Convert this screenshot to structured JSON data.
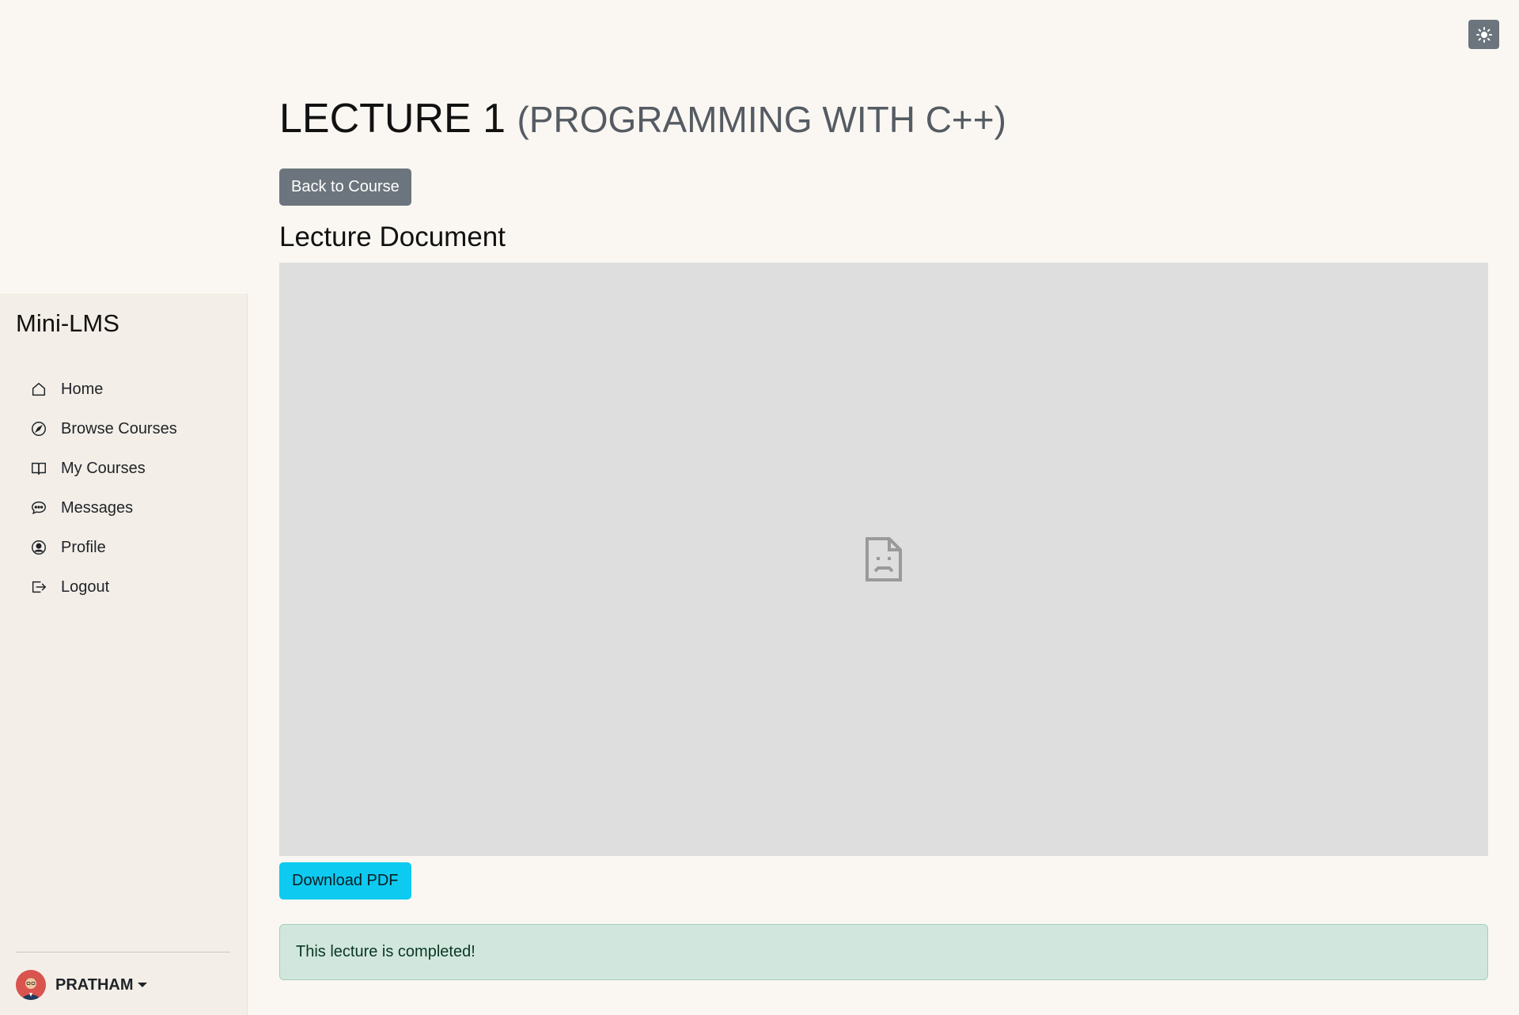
{
  "app": {
    "brand": "Mini-LMS",
    "theme_toggle_icon": "sun-icon"
  },
  "sidebar": {
    "items": [
      {
        "label": "Home",
        "icon": "home-icon"
      },
      {
        "label": "Browse Courses",
        "icon": "compass-icon"
      },
      {
        "label": "My Courses",
        "icon": "book-icon"
      },
      {
        "label": "Messages",
        "icon": "chat-icon"
      },
      {
        "label": "Profile",
        "icon": "user-circle-icon"
      },
      {
        "label": "Logout",
        "icon": "logout-icon"
      }
    ],
    "user": {
      "name": "PRATHAM",
      "avatar": "avatar-icon"
    }
  },
  "main": {
    "title": "LECTURE 1",
    "subtitle": "(PROGRAMMING WITH C++)",
    "back_button": "Back to Course",
    "section_title": "Lecture Document",
    "viewer_icon": "broken-document-icon",
    "download_button": "Download PDF",
    "status_message": "This lecture is completed!"
  },
  "colors": {
    "page_bg": "#faf7f2",
    "sidebar_bg": "#f3eee7",
    "secondary_button": "#6c757d",
    "info_button": "#0dcaf0",
    "success_alert_bg": "#d1e7dd",
    "viewer_bg": "#dedede"
  }
}
